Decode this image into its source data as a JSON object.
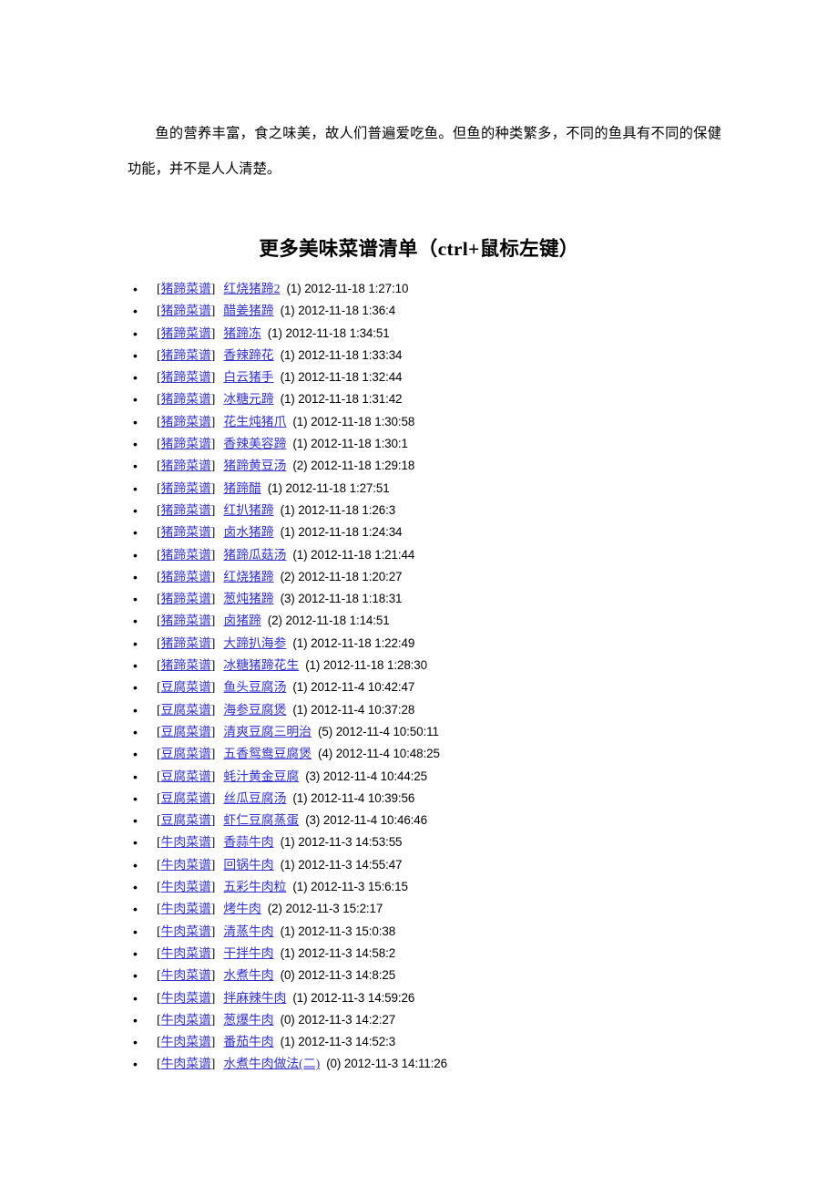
{
  "document": {
    "intro_paragraph": "鱼的营养丰富，食之味美，故人们普遍爱吃鱼。但鱼的种类繁多，不同的鱼具有不同的保健功能，并不是人人清楚。",
    "heading": "更多美味菜谱清单（ctrl+鼠标左键）",
    "bracket_open": "[",
    "bracket_close": "]"
  },
  "colors": {
    "link": "#3333cc",
    "text": "#000000",
    "background": "#ffffff"
  },
  "list": {
    "items": [
      {
        "category": "猪蹄菜谱",
        "title": "红烧猪蹄2",
        "count": "(1)",
        "timestamp": "2012-11-18 1:27:10"
      },
      {
        "category": "猪蹄菜谱",
        "title": "醋姜猪蹄",
        "count": "(1)",
        "timestamp": "2012-11-18 1:36:4"
      },
      {
        "category": "猪蹄菜谱",
        "title": "猪蹄冻",
        "count": "(1)",
        "timestamp": "2012-11-18 1:34:51"
      },
      {
        "category": "猪蹄菜谱",
        "title": "香辣蹄花",
        "count": "(1)",
        "timestamp": "2012-11-18 1:33:34"
      },
      {
        "category": "猪蹄菜谱",
        "title": "白云猪手",
        "count": "(1)",
        "timestamp": "2012-11-18 1:32:44"
      },
      {
        "category": "猪蹄菜谱",
        "title": "冰糖元蹄",
        "count": "(1)",
        "timestamp": "2012-11-18 1:31:42"
      },
      {
        "category": "猪蹄菜谱",
        "title": "花生炖猪爪",
        "count": "(1)",
        "timestamp": "2012-11-18 1:30:58"
      },
      {
        "category": "猪蹄菜谱",
        "title": "香辣美容蹄",
        "count": "(1)",
        "timestamp": "2012-11-18 1:30:1"
      },
      {
        "category": "猪蹄菜谱",
        "title": "猪蹄黄豆汤",
        "count": "(2)",
        "timestamp": "2012-11-18 1:29:18"
      },
      {
        "category": "猪蹄菜谱",
        "title": "猪蹄醋",
        "count": "(1)",
        "timestamp": "2012-11-18 1:27:51"
      },
      {
        "category": "猪蹄菜谱",
        "title": "红扒猪蹄",
        "count": "(1)",
        "timestamp": "2012-11-18 1:26:3"
      },
      {
        "category": "猪蹄菜谱",
        "title": "卤水猪蹄",
        "count": "(1)",
        "timestamp": "2012-11-18 1:24:34"
      },
      {
        "category": "猪蹄菜谱",
        "title": "猪蹄瓜菇汤",
        "count": "(1)",
        "timestamp": "2012-11-18 1:21:44"
      },
      {
        "category": "猪蹄菜谱",
        "title": "红烧猪蹄",
        "count": "(2)",
        "timestamp": "2012-11-18 1:20:27"
      },
      {
        "category": "猪蹄菜谱",
        "title": "葱炖猪蹄",
        "count": "(3)",
        "timestamp": "2012-11-18 1:18:31"
      },
      {
        "category": "猪蹄菜谱",
        "title": "卤猪蹄",
        "count": "(2)",
        "timestamp": "2012-11-18 1:14:51"
      },
      {
        "category": "猪蹄菜谱",
        "title": "大蹄扒海参",
        "count": "(1)",
        "timestamp": "2012-11-18 1:22:49"
      },
      {
        "category": "猪蹄菜谱",
        "title": "冰糖猪蹄花生",
        "count": "(1)",
        "timestamp": "2012-11-18 1:28:30"
      },
      {
        "category": "豆腐菜谱",
        "title": "鱼头豆腐汤",
        "count": "(1)",
        "timestamp": "2012-11-4 10:42:47"
      },
      {
        "category": "豆腐菜谱",
        "title": "海参豆腐煲",
        "count": "(1)",
        "timestamp": "2012-11-4 10:37:28"
      },
      {
        "category": "豆腐菜谱",
        "title": "清爽豆腐三明治",
        "count": "(5)",
        "timestamp": "2012-11-4 10:50:11"
      },
      {
        "category": "豆腐菜谱",
        "title": "五香鸳鸯豆腐煲",
        "count": "(4)",
        "timestamp": "2012-11-4 10:48:25"
      },
      {
        "category": "豆腐菜谱",
        "title": "蚝汁黄金豆腐",
        "count": "(3)",
        "timestamp": "2012-11-4 10:44:25"
      },
      {
        "category": "豆腐菜谱",
        "title": "丝瓜豆腐汤",
        "count": "(1)",
        "timestamp": "2012-11-4 10:39:56"
      },
      {
        "category": "豆腐菜谱",
        "title": "虾仁豆腐蒸蛋",
        "count": "(3)",
        "timestamp": "2012-11-4 10:46:46"
      },
      {
        "category": "牛肉菜谱",
        "title": "香蒜牛肉",
        "count": "(1)",
        "timestamp": "2012-11-3 14:53:55"
      },
      {
        "category": "牛肉菜谱",
        "title": "回锅牛肉",
        "count": "(1)",
        "timestamp": "2012-11-3 14:55:47"
      },
      {
        "category": "牛肉菜谱",
        "title": "五彩牛肉粒",
        "count": "(1)",
        "timestamp": "2012-11-3 15:6:15"
      },
      {
        "category": "牛肉菜谱",
        "title": "烤牛肉",
        "count": "(2)",
        "timestamp": "2012-11-3 15:2:17"
      },
      {
        "category": "牛肉菜谱",
        "title": "清蒸牛肉",
        "count": "(1)",
        "timestamp": "2012-11-3 15:0:38"
      },
      {
        "category": "牛肉菜谱",
        "title": "干拌牛肉",
        "count": "(1)",
        "timestamp": "2012-11-3 14:58:2"
      },
      {
        "category": "牛肉菜谱",
        "title": "水煮牛肉",
        "count": "(0)",
        "timestamp": "2012-11-3 14:8:25"
      },
      {
        "category": "牛肉菜谱",
        "title": "拌麻辣牛肉",
        "count": "(1)",
        "timestamp": "2012-11-3 14:59:26"
      },
      {
        "category": "牛肉菜谱",
        "title": "葱爆牛肉",
        "count": "(0)",
        "timestamp": "2012-11-3 14:2:27"
      },
      {
        "category": "牛肉菜谱",
        "title": "番茄牛肉",
        "count": "(1)",
        "timestamp": "2012-11-3 14:52:3"
      },
      {
        "category": "牛肉菜谱",
        "title": "水煮牛肉做法(二)",
        "count": "(0)",
        "timestamp": "2012-11-3 14:11:26"
      }
    ]
  }
}
